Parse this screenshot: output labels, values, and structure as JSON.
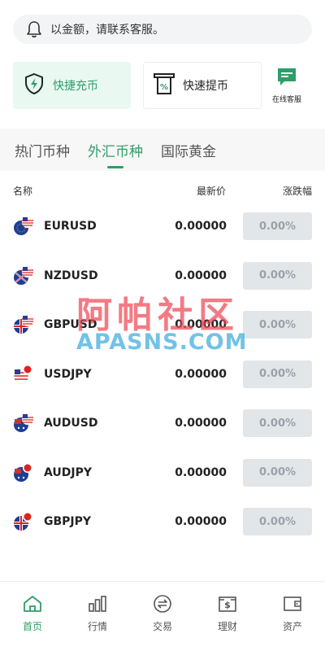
{
  "notice": {
    "text": "以金额，请联系客服。"
  },
  "actions": {
    "deposit_label": "快捷充币",
    "withdraw_label": "快速提币",
    "service_label": "在线客服"
  },
  "tabs": [
    {
      "label": "热门币种",
      "active": false
    },
    {
      "label": "外汇币种",
      "active": true
    },
    {
      "label": "国际黄金",
      "active": false
    }
  ],
  "table": {
    "col_name": "名称",
    "col_price": "最新价",
    "col_change": "涨跌幅",
    "rows": [
      {
        "symbol": "EURUSD",
        "price": "0.00000",
        "change": "0.00%"
      },
      {
        "symbol": "NZDUSD",
        "price": "0.00000",
        "change": "0.00%"
      },
      {
        "symbol": "GBPUSD",
        "price": "0.00000",
        "change": "0.00%"
      },
      {
        "symbol": "USDJPY",
        "price": "0.00000",
        "change": "0.00%"
      },
      {
        "symbol": "AUDUSD",
        "price": "0.00000",
        "change": "0.00%"
      },
      {
        "symbol": "AUDJPY",
        "price": "0.00000",
        "change": "0.00%"
      },
      {
        "symbol": "GBPJPY",
        "price": "0.00000",
        "change": "0.00%"
      }
    ]
  },
  "watermark": {
    "cn": "阿帕社区",
    "en": "APASNS.COM"
  },
  "nav": [
    {
      "label": "首页",
      "icon": "home-icon",
      "active": true
    },
    {
      "label": "行情",
      "icon": "bar-chart-icon",
      "active": false
    },
    {
      "label": "交易",
      "icon": "exchange-icon",
      "active": false
    },
    {
      "label": "理财",
      "icon": "wallet-dollar-icon",
      "active": false
    },
    {
      "label": "资产",
      "icon": "wallet-icon",
      "active": false
    }
  ],
  "colors": {
    "accent": "#2f9d68",
    "change_bg": "#e3e6e9",
    "change_text": "#9aa1a8"
  }
}
